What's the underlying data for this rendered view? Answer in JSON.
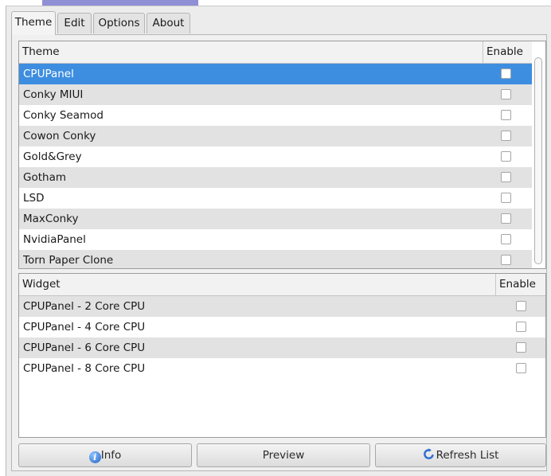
{
  "tabs": [
    {
      "label": "Theme"
    },
    {
      "label": "Edit"
    },
    {
      "label": "Options"
    },
    {
      "label": "About"
    }
  ],
  "theme_list": {
    "header_name": "Theme",
    "header_enable": "Enable",
    "selected_index": 0,
    "rows": [
      {
        "name": "CPUPanel",
        "enabled": false
      },
      {
        "name": "Conky MIUI",
        "enabled": false
      },
      {
        "name": "Conky Seamod",
        "enabled": false
      },
      {
        "name": "Cowon Conky",
        "enabled": false
      },
      {
        "name": "Gold&Grey",
        "enabled": false
      },
      {
        "name": "Gotham",
        "enabled": false
      },
      {
        "name": "LSD",
        "enabled": false
      },
      {
        "name": "MaxConky",
        "enabled": false
      },
      {
        "name": "NvidiaPanel",
        "enabled": false
      },
      {
        "name": "Torn Paper Clone",
        "enabled": false
      }
    ]
  },
  "widget_list": {
    "header_name": "Widget",
    "header_enable": "Enable",
    "rows": [
      {
        "name": "CPUPanel - 2 Core CPU",
        "enabled": false
      },
      {
        "name": "CPUPanel - 4 Core CPU",
        "enabled": false
      },
      {
        "name": "CPUPanel - 6 Core CPU",
        "enabled": false
      },
      {
        "name": "CPUPanel - 8 Core CPU",
        "enabled": false
      }
    ]
  },
  "buttons": {
    "info_label": "Info",
    "info_icon": "info-icon",
    "preview_label": "Preview",
    "refresh_label": "Refresh List",
    "refresh_icon": "refresh-icon"
  },
  "colors": {
    "selection": "#3d8ee0",
    "alt_row": "#e2e2e2",
    "window_bg": "#ececec"
  }
}
